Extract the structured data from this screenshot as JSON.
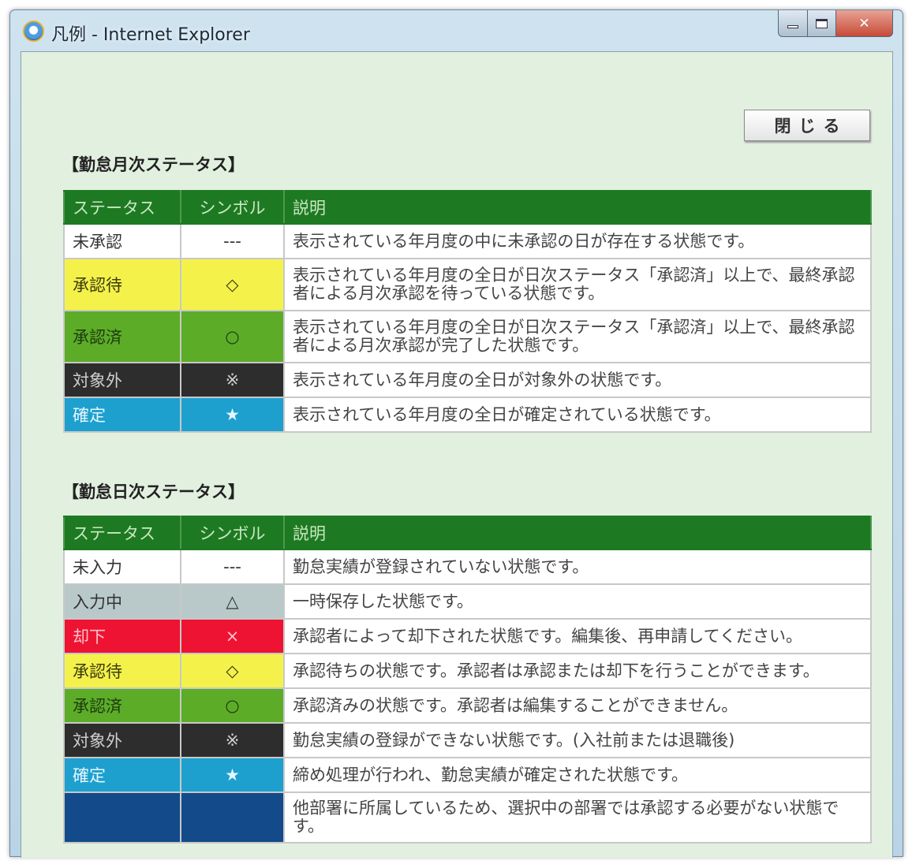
{
  "window": {
    "title": "凡例 - Internet Explorer"
  },
  "close_button": {
    "label": "閉じる"
  },
  "monthly": {
    "title": "【勤怠月次ステータス】",
    "headers": {
      "status": "ステータス",
      "symbol": "シンボル",
      "description": "説明"
    },
    "rows": [
      {
        "status": "未承認",
        "symbol": "---",
        "description": "表示されている年月度の中に未承認の日が存在する状態です。",
        "color": "#ffffff"
      },
      {
        "status": "承認待",
        "symbol": "◇",
        "description": "表示されている年月度の全日が日次ステータス「承認済」以上で、最終承認者による月次承認を待っている状態です。",
        "color": "#f4f24a"
      },
      {
        "status": "承認済",
        "symbol": "○",
        "description": "表示されている年月度の全日が日次ステータス「承認済」以上で、最終承認者による月次承認が完了した状態です。",
        "color": "#5cac28"
      },
      {
        "status": "対象外",
        "symbol": "※",
        "description": "表示されている年月度の全日が対象外の状態です。",
        "color": "#2d2d2d"
      },
      {
        "status": "確定",
        "symbol": "★",
        "description": "表示されている年月度の全日が確定されている状態です。",
        "color": "#1ea0cf"
      }
    ]
  },
  "daily": {
    "title": "【勤怠日次ステータス】",
    "headers": {
      "status": "ステータス",
      "symbol": "シンボル",
      "description": "説明"
    },
    "rows": [
      {
        "status": "未入力",
        "symbol": "---",
        "description": "勤怠実績が登録されていない状態です。",
        "color": "#ffffff"
      },
      {
        "status": "入力中",
        "symbol": "△",
        "description": "一時保存した状態です。",
        "color": "#b9c9c9"
      },
      {
        "status": "却下",
        "symbol": "×",
        "description": "承認者によって却下された状態です。編集後、再申請してください。",
        "color": "#ee1332"
      },
      {
        "status": "承認待",
        "symbol": "◇",
        "description": "承認待ちの状態です。承認者は承認または却下を行うことができます。",
        "color": "#f4f24a"
      },
      {
        "status": "承認済",
        "symbol": "○",
        "description": "承認済みの状態です。承認者は編集することができません。",
        "color": "#5cac28"
      },
      {
        "status": "対象外",
        "symbol": "※",
        "description": "勤怠実績の登録ができない状態です。(入社前または退職後)",
        "color": "#2d2d2d"
      },
      {
        "status": "確定",
        "symbol": "★",
        "description": "締め処理が行われ、勤怠実績が確定された状態です。",
        "color": "#1ea0cf"
      },
      {
        "status": "",
        "symbol": "",
        "description": "他部署に所属しているため、選択中の部署では承認する必要がない状態です。",
        "color": "#124a8a"
      }
    ]
  }
}
